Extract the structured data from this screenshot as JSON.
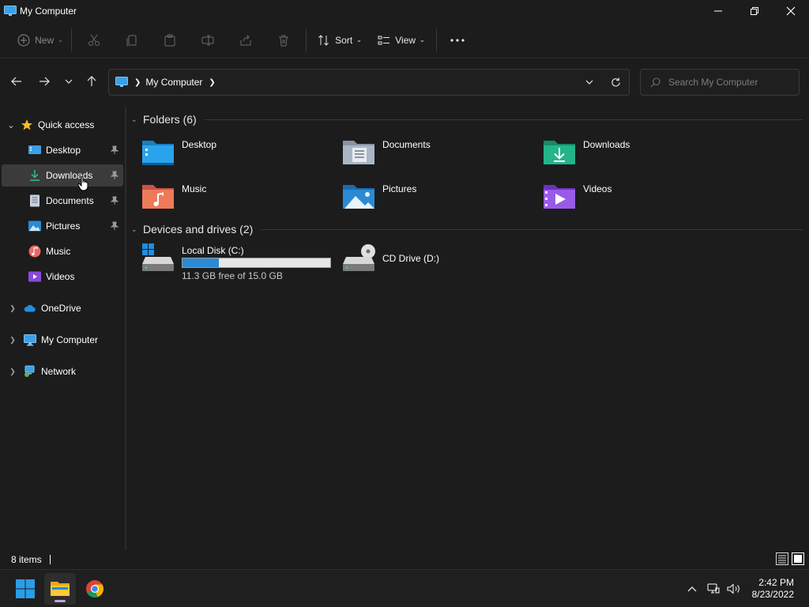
{
  "window": {
    "title": "My Computer"
  },
  "toolbar": {
    "new_label": "New",
    "sort_label": "Sort",
    "view_label": "View"
  },
  "address": {
    "crumbs": [
      "My Computer"
    ],
    "search_placeholder": "Search My Computer"
  },
  "sidebar": {
    "quick_access": "Quick access",
    "items": [
      {
        "label": "Desktop",
        "icon": "desktop-icon",
        "pinned": true
      },
      {
        "label": "Downloads",
        "icon": "download-icon",
        "pinned": true,
        "selected": true
      },
      {
        "label": "Documents",
        "icon": "documents-icon",
        "pinned": true
      },
      {
        "label": "Pictures",
        "icon": "pictures-icon",
        "pinned": true
      },
      {
        "label": "Music",
        "icon": "music-icon",
        "pinned": false
      },
      {
        "label": "Videos",
        "icon": "videos-icon",
        "pinned": false
      }
    ],
    "onedrive": "OneDrive",
    "my_computer": "My Computer",
    "network": "Network"
  },
  "content": {
    "folders_title": "Folders (6)",
    "folders": [
      {
        "label": "Desktop",
        "icon": "desktop-folder-icon"
      },
      {
        "label": "Documents",
        "icon": "documents-folder-icon"
      },
      {
        "label": "Downloads",
        "icon": "downloads-folder-icon"
      },
      {
        "label": "Music",
        "icon": "music-folder-icon"
      },
      {
        "label": "Pictures",
        "icon": "pictures-folder-icon"
      },
      {
        "label": "Videos",
        "icon": "videos-folder-icon"
      }
    ],
    "drives_title": "Devices and drives (2)",
    "drives": [
      {
        "label": "Local Disk (C:)",
        "free_text": "11.3 GB free of 15.0 GB",
        "used_fraction": 0.247
      },
      {
        "label": "CD Drive (D:)"
      }
    ]
  },
  "status": {
    "item_count": "8 items"
  },
  "taskbar": {
    "time": "2:42 PM",
    "date": "8/23/2022"
  },
  "colors": {
    "accent": "#2a8ad4",
    "background": "#1c1c1c",
    "selection": "#3b3b3b"
  }
}
